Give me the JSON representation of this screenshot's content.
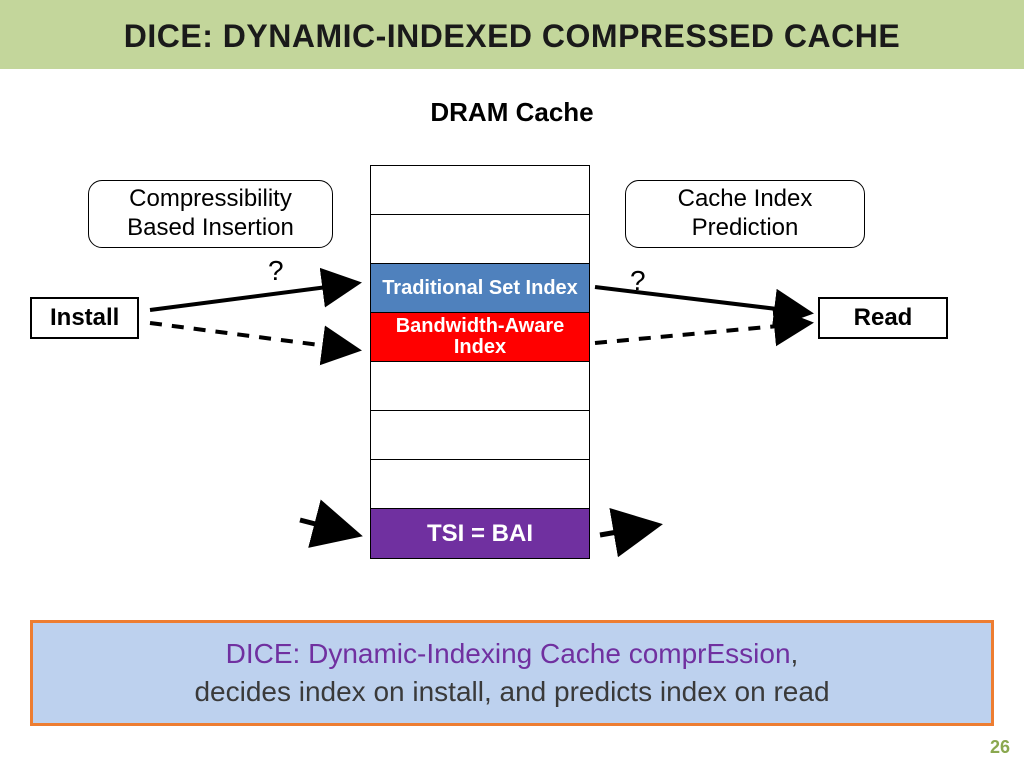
{
  "title": "DICE: DYNAMIC-INDEXED COMPRESSED CACHE",
  "subtitle": "DRAM Cache",
  "left_side": {
    "line1": "Compressibility",
    "line2": "Based Insertion"
  },
  "right_side": {
    "line1": "Cache Index",
    "line2": "Prediction"
  },
  "actions": {
    "install": "Install",
    "read": "Read"
  },
  "qmarks": {
    "left": "?",
    "right": "?"
  },
  "cache": {
    "trad": "Traditional Set Index",
    "bw": "Bandwidth-Aware Index",
    "tsi": "TSI = BAI"
  },
  "callout": {
    "purple": "DICE: Dynamic-Indexing Cache comprEssion",
    "rest_prefix": ",",
    "rest_line2": "decides index on install, and predicts index on read"
  },
  "page": "26"
}
